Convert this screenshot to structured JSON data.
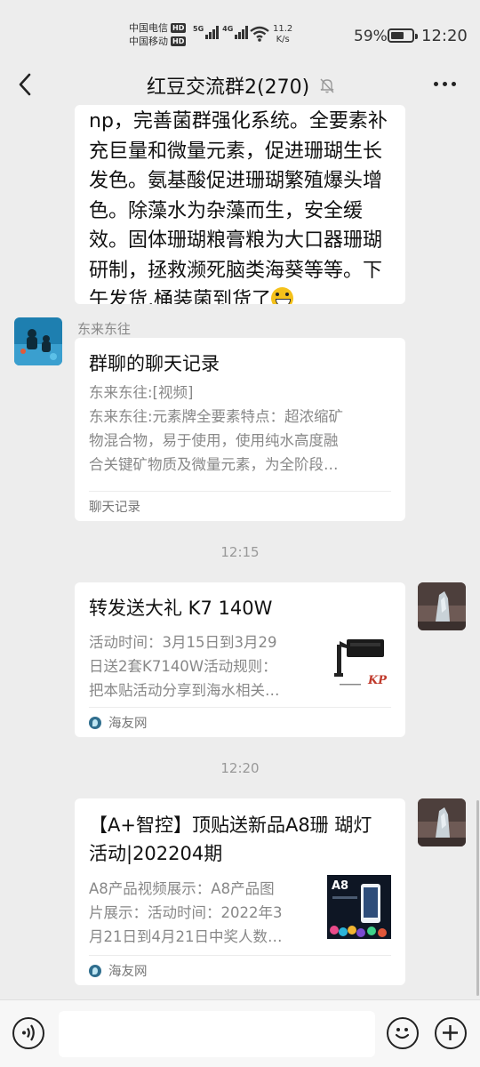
{
  "status_bar": {
    "carrier1": "中国电信",
    "carrier2": "中国移动",
    "hd": "HD",
    "net1": "5G",
    "net2": "4G",
    "speed_value": "11.2",
    "speed_unit": "K/s",
    "battery": "59%",
    "battery_level": 0.59,
    "time": "12:20"
  },
  "nav": {
    "title": "红豆交流群2(270)"
  },
  "messages": {
    "text_message": {
      "lines": [
        "np，完善菌群强化系统。全要素补",
        "充巨量和微量元素，促进珊瑚生长",
        "发色。氨基酸促进珊瑚繁殖爆头增",
        "色。除藻水为杂藻而生，安全缓",
        "效。固体珊瑚粮膏粮为大口器珊瑚",
        "研制，拯救濒死脑类海葵等等。下",
        "午发货,桶装菌到货了"
      ]
    },
    "chat_record": {
      "sender": "东来东往",
      "title": "群聊的聊天记录",
      "lines": [
        "东来东往:[视频]",
        "东来东往:元素牌全要素特点：超浓缩矿",
        "物混合物，易于使用，使用纯水高度融",
        "合关键矿物质及微量元素，为全阶段…"
      ],
      "footer": "聊天记录"
    },
    "time1": "12:15",
    "link1": {
      "title": "转发送大礼  K7 140W",
      "lines": [
        "活动时间：3月15日到3月29",
        "日送2套K7140W活动规则：",
        "把本贴活动分享到海水相关…"
      ],
      "source": "海友网"
    },
    "time2": "12:20",
    "link2": {
      "title_lines": [
        "【A+智控】顶贴送新品A8珊 瑚灯",
        "活动|202204期"
      ],
      "lines": [
        "A8产品视频展示：A8产品图",
        "片展示：活动时间：2022年3",
        "月21日到4月21日中奖人数…"
      ],
      "source": "海友网",
      "thumb_label": "A8"
    }
  }
}
